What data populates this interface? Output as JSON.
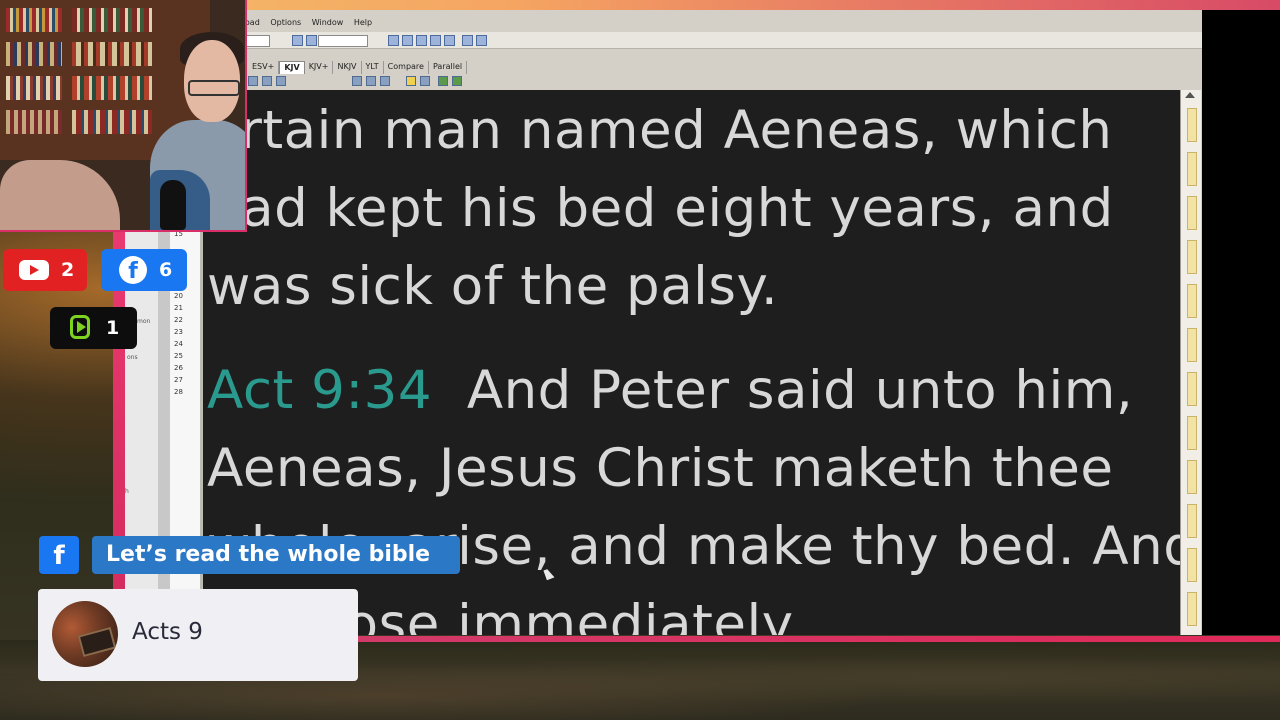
{
  "app": {
    "menu": [
      "Download",
      "Options",
      "Window",
      "Help"
    ],
    "tabs": [
      "ESV+",
      "KJV",
      "KJV+",
      "NKJV",
      "YLT",
      "Compare",
      "Parallel"
    ],
    "active_tab": "KJV"
  },
  "reader": {
    "line1": "ertain man named Aeneas, which",
    "line2": "had kept his bed eight years, and",
    "line3": "was sick of the palsy.",
    "verse_ref": "Act 9:34",
    "line4_rest": "And Peter said unto him,",
    "line5": "Aeneas, Jesus Christ maketh thee",
    "line6": "whole: arise, and make thy bed. And",
    "line7": "he arose immediately."
  },
  "chapter_numbers": [
    "14",
    "15",
    "20",
    "21",
    "22",
    "23",
    "24",
    "25",
    "26",
    "27",
    "28"
  ],
  "side_labels": {
    "a": "mon",
    "b": "ons",
    "c": "h"
  },
  "social": {
    "youtube_count": "2",
    "facebook_count": "6",
    "rumble_count": "1"
  },
  "lower_third": {
    "fb_letter": "f",
    "title": "Let’s read the whole bible",
    "subtitle": "Acts 9"
  },
  "colors": {
    "verse_ref": "#2a9a8e",
    "accent_pink": "#d92f69",
    "youtube": "#e22222",
    "facebook": "#1a77f2"
  }
}
